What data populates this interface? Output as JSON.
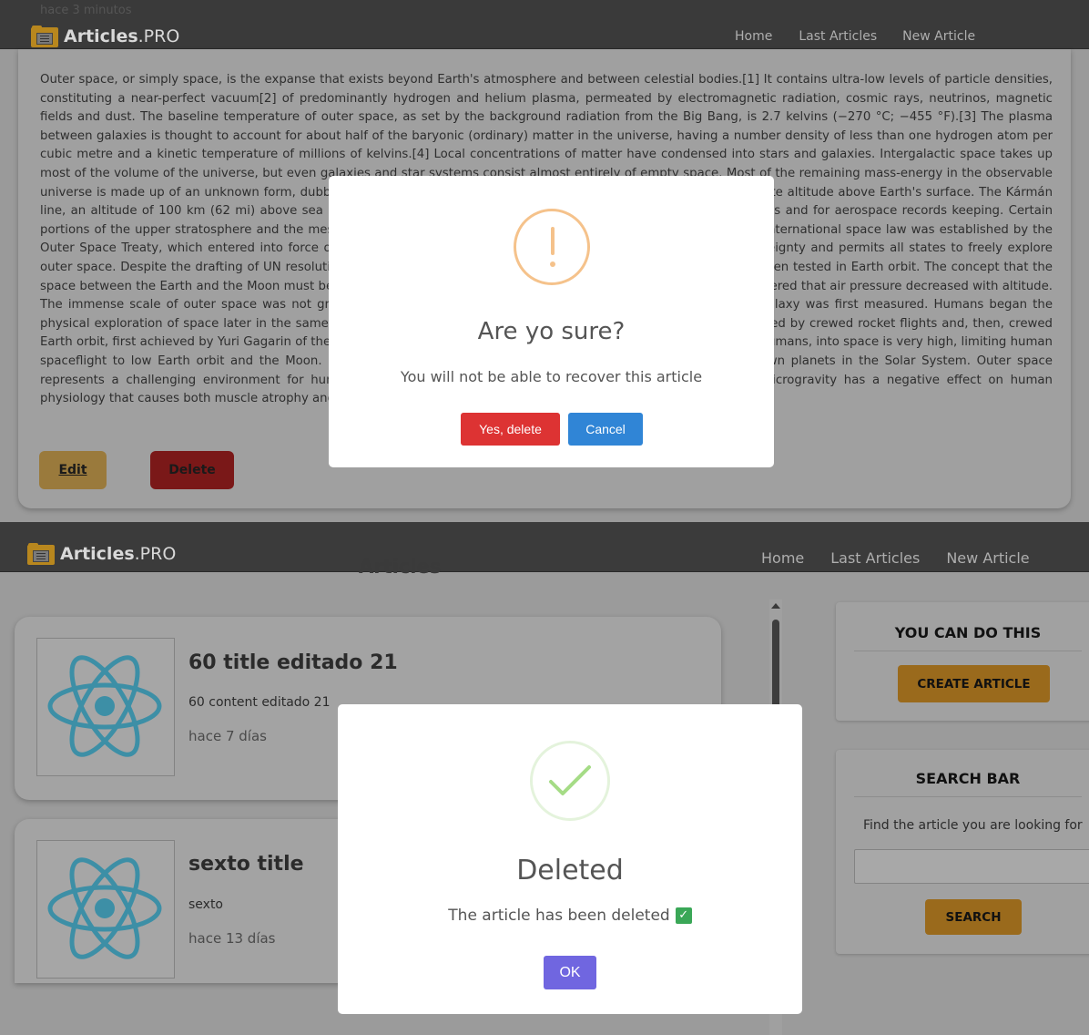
{
  "top_screen": {
    "faded_time": "hace 3 minutos",
    "brand": {
      "name": "Articles",
      "suffix": ".PRO"
    },
    "nav": [
      "Home",
      "Last Articles",
      "New Article"
    ],
    "article_body": "Outer space, or simply space, is the expanse that exists beyond Earth's atmosphere and between celestial bodies.[1] It contains ultra-low levels of particle densities, constituting a near-perfect vacuum[2] of predominantly hydrogen and helium plasma, permeated by electromagnetic radiation, cosmic rays, neutrinos, magnetic fields and dust. The baseline temperature of outer space, as set by the background radiation from the Big Bang, is 2.7 kelvins (−270 °C; −455 °F).[3] The plasma between galaxies is thought to account for about half of the baryonic (ordinary) matter in the universe, having a number density of less than one hydrogen atom per cubic metre and a kinetic temperature of millions of kelvins.[4] Local concentrations of matter have condensed into stars and galaxies. Intergalactic space takes up most of the volume of the universe, but even galaxies and star systems consist almost entirely of empty space. Most of the remaining mass-energy in the observable universe is made up of an unknown form, dubbed dark matter and dark energy. Outer space does not begin at a definite altitude above Earth's surface. The Kármán line, an altitude of 100 km (62 mi) above sea level, is conventionally used as the start of outer space in space treaties and for aerospace records keeping. Certain portions of the upper stratosphere and the mesosphere are sometimes referred to as near space. The framework for international space law was established by the Outer Space Treaty, which entered into force on 10 October 1967. This treaty precludes any claims of national sovereignty and permits all states to freely explore outer space. Despite the drafting of UN resolutions for the peaceful uses of outer space, anti-satellite weapons have been tested in Earth orbit. The concept that the space between the Earth and the Moon must be a vacuum was first proposed in the 17th century after scientists discovered that air pressure decreased with altitude. The immense scale of outer space was not grasped until the 20th century, when the distance to the Andromeda Galaxy was first measured. Humans began the physical exploration of space later in the same century with the advent of high-altitude balloon flights. This was followed by crewed rocket flights and, then, crewed Earth orbit, first achieved by Yuri Gagarin of the Soviet Union in 1961. The economic cost of putting objects, including humans, into space is very high, limiting human spaceflight to low Earth orbit and the Moon. On the other hand, uncrewed spacecraft have reached all of the known planets in the Solar System. Outer space represents a challenging environment for human exploration because of the hazards of vacuum and radiation. Microgravity has a negative effect on human physiology that causes both muscle atrophy and bone loss.",
    "edit_label": "Edit",
    "delete_label": "Delete",
    "modal": {
      "icon": "warning-icon",
      "title": "Are yo sure?",
      "text": "You will not be able to recover this article",
      "confirm_label": "Yes, delete",
      "cancel_label": "Cancel",
      "confirm_color": "#dd3333",
      "cancel_color": "#3085d6"
    }
  },
  "bottom_screen": {
    "brand": {
      "name": "Articles",
      "suffix": ".PRO"
    },
    "nav": [
      "Home",
      "Last Articles",
      "New Article"
    ],
    "page_heading": "Articles",
    "articles": [
      {
        "title": "60 title editado 21",
        "content": "60 content editado 21",
        "date": "hace 7 días",
        "icon": "react-logo-icon"
      },
      {
        "title": "sexto title",
        "content": "sexto",
        "date": "hace 13 días",
        "icon": "react-logo-icon"
      }
    ],
    "sidebar": {
      "actions_title": "YOU CAN DO THIS",
      "create_label": "CREATE ARTICLE",
      "search_title": "SEARCH BAR",
      "search_text": "Find the article you are looking for",
      "search_button": "SEARCH",
      "search_value": ""
    },
    "modal": {
      "icon": "success-check-icon",
      "title": "Deleted",
      "text": "The article has been deleted",
      "badge": "✓",
      "ok_label": "OK",
      "ok_color": "#7066e0"
    }
  }
}
